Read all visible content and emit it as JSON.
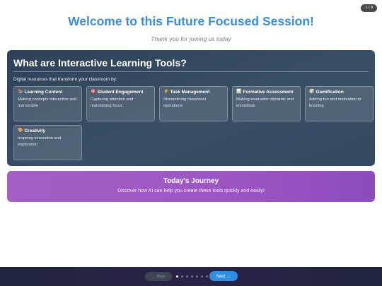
{
  "page_counter": "1 / 8",
  "header": {
    "title": "Welcome to this Future Focused Session!",
    "subtitle": "Thank you for joining us today"
  },
  "main": {
    "heading": "What are Interactive Learning Tools?",
    "intro": "Digital resources that transform your classroom by:",
    "tools": [
      {
        "icon": "📚",
        "icon_name": "books-icon",
        "title": "Learning Content",
        "desc": "Making concepts interactive and memorable"
      },
      {
        "icon": "🎯",
        "icon_name": "target-icon",
        "title": "Student Engagement",
        "desc": "Capturing attention and maintaining focus"
      },
      {
        "icon": "⚡",
        "icon_name": "lightning-icon",
        "title": "Task Management",
        "desc": "Streamlining classroom operations"
      },
      {
        "icon": "📊",
        "icon_name": "bar-chart-icon",
        "title": "Formative Assessment",
        "desc": "Making evaluation dynamic and immediate"
      },
      {
        "icon": "🎲",
        "icon_name": "dice-icon",
        "title": "Gamification",
        "desc": "Adding fun and motivation to learning"
      },
      {
        "icon": "🎨",
        "icon_name": "palette-icon",
        "title": "Creativity",
        "desc": "Inspiring innovation and exploration"
      }
    ]
  },
  "journey": {
    "title": "Today's Journey",
    "text": "Discover how AI can help you create these tools quickly and easily!"
  },
  "footer": {
    "prev_label": "← Prev",
    "next_label": "Next →",
    "total_slides": 8,
    "current_slide": 1
  },
  "colors": {
    "title": "#3a8fd6",
    "card": "#344a61",
    "journey": "#9b56c2",
    "next_button": "#2f8fe0",
    "footer": "#241f45"
  }
}
